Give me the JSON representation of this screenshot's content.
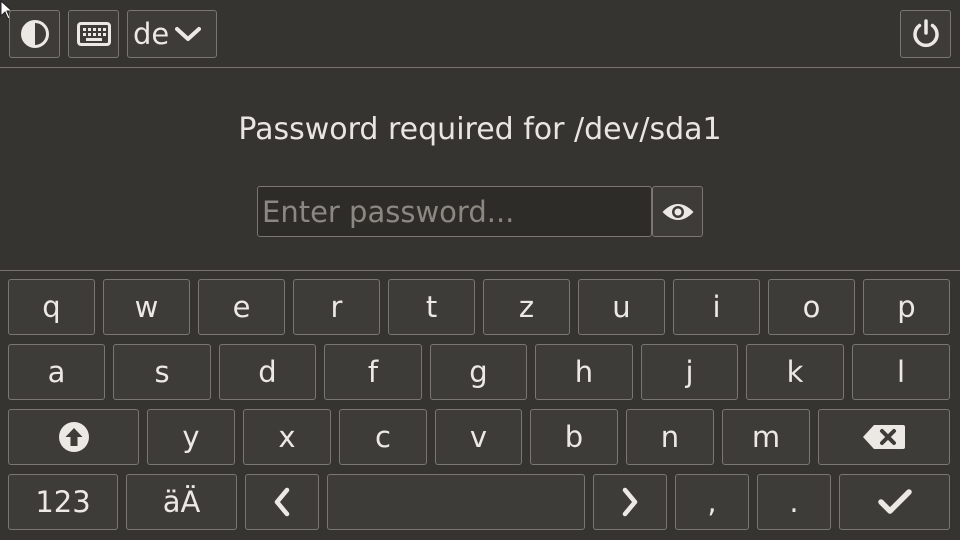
{
  "topbar": {
    "contrast_icon": "contrast-icon",
    "keyboard_icon": "keyboard-icon",
    "layout_label": "de",
    "dropdown_icon": "chevron-down-icon",
    "power_icon": "power-icon"
  },
  "prompt": {
    "title": "Password required for /dev/sda1",
    "placeholder": "Enter password...",
    "value": "",
    "reveal_icon": "eye-icon"
  },
  "keyboard": {
    "row1": [
      "q",
      "w",
      "e",
      "r",
      "t",
      "z",
      "u",
      "i",
      "o",
      "p"
    ],
    "row2": [
      "a",
      "s",
      "d",
      "f",
      "g",
      "h",
      "j",
      "k",
      "l"
    ],
    "row3": [
      "y",
      "x",
      "c",
      "v",
      "b",
      "n",
      "m"
    ],
    "row4": {
      "numbers": "123",
      "umlaut": "äÄ",
      "comma": ",",
      "period": "."
    },
    "icons": {
      "shift": "shift-arrow-up-icon",
      "backspace": "backspace-icon",
      "left": "chevron-left-icon",
      "right": "chevron-right-icon",
      "enter": "checkmark-icon"
    }
  },
  "colors": {
    "background": "#363430",
    "key_background": "#3e3c39",
    "input_background": "#2e2c29",
    "border": "#7a7771",
    "text": "#ece9e4"
  }
}
